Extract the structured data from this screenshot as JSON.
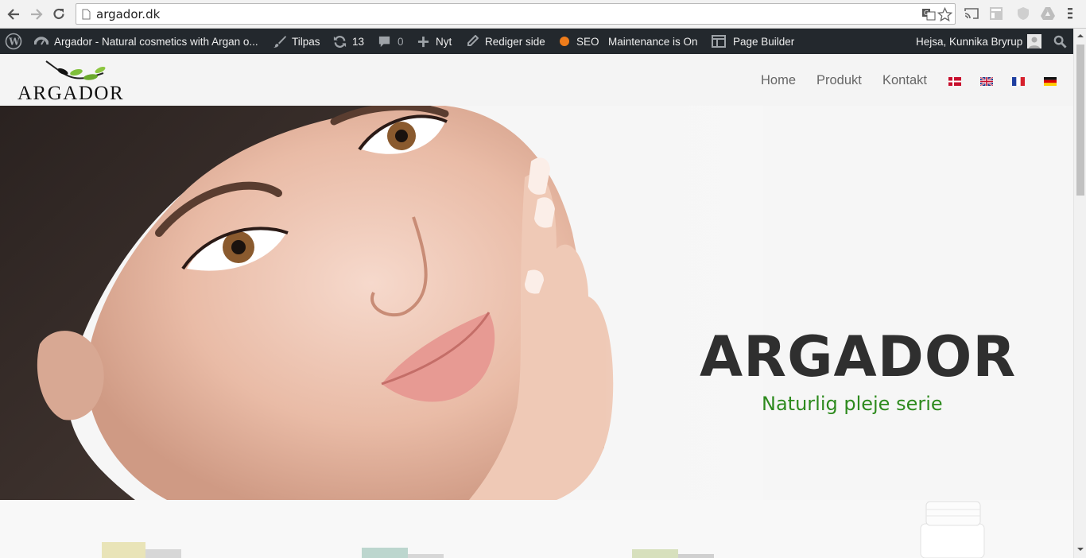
{
  "browser": {
    "url": "argador.dk"
  },
  "adminbar": {
    "site_name": "Argador - Natural cosmetics with Argan o...",
    "customize": "Tilpas",
    "updates_count": "13",
    "comments_count": "0",
    "new": "Nyt",
    "edit_page": "Rediger side",
    "seo": "SEO",
    "maintenance": "Maintenance is On",
    "page_builder": "Page Builder",
    "greeting": "Hejsa, Kunnika Bryrup"
  },
  "site": {
    "logo_text": "ARGADOR",
    "menu": [
      "Home",
      "Produkt",
      "Kontakt"
    ],
    "languages": [
      "Danish",
      "English",
      "French",
      "German"
    ]
  },
  "hero": {
    "title": "ARGADOR",
    "subtitle": "Naturlig pleje serie"
  },
  "colors": {
    "adminbar_bg": "#23282d",
    "accent_green": "#2d8a1d",
    "seo_orange": "#ee7c1b"
  }
}
